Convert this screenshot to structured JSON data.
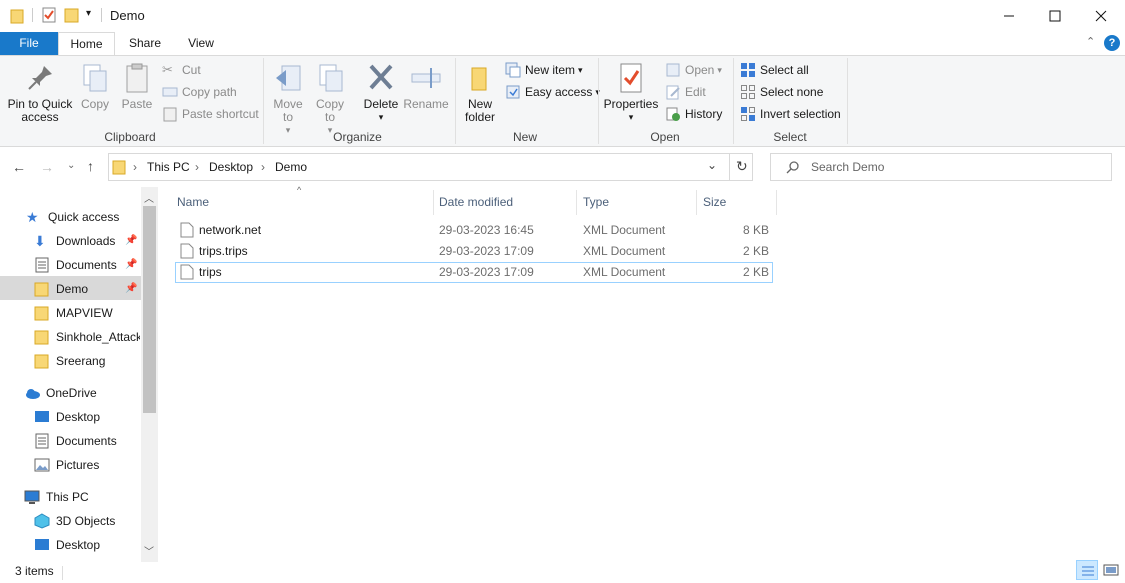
{
  "window": {
    "title": "Demo"
  },
  "tabs": {
    "file": "File",
    "home": "Home",
    "share": "Share",
    "view": "View"
  },
  "ribbon": {
    "clipboard": {
      "label": "Clipboard",
      "pin": "Pin to Quick access",
      "copy": "Copy",
      "paste": "Paste",
      "cut": "Cut",
      "copy_path": "Copy path",
      "paste_shortcut": "Paste shortcut"
    },
    "organize": {
      "label": "Organize",
      "move_to": "Move to",
      "copy_to": "Copy to",
      "delete": "Delete",
      "rename": "Rename"
    },
    "new": {
      "label": "New",
      "new_folder": "New folder",
      "new_item": "New item",
      "easy_access": "Easy access"
    },
    "open": {
      "label": "Open",
      "properties": "Properties",
      "open": "Open",
      "edit": "Edit",
      "history": "History"
    },
    "select": {
      "label": "Select",
      "select_all": "Select all",
      "select_none": "Select none",
      "invert": "Invert selection"
    }
  },
  "address": {
    "crumbs": [
      "This PC",
      "Desktop",
      "Demo"
    ],
    "search_placeholder": "Search Demo"
  },
  "nav": {
    "quick_access": "Quick access",
    "items": [
      {
        "label": "Downloads",
        "pinned": true
      },
      {
        "label": "Documents",
        "pinned": true
      },
      {
        "label": "Demo",
        "pinned": true
      },
      {
        "label": "MAPVIEW",
        "pinned": false
      },
      {
        "label": "Sinkhole_Attack_",
        "pinned": false
      },
      {
        "label": "Sreerang",
        "pinned": false
      }
    ],
    "onedrive": "OneDrive",
    "onedrive_items": [
      "Desktop",
      "Documents",
      "Pictures"
    ],
    "this_pc": "This PC",
    "this_pc_items": [
      "3D Objects",
      "Desktop"
    ]
  },
  "columns": {
    "name": "Name",
    "date": "Date modified",
    "type": "Type",
    "size": "Size"
  },
  "files": [
    {
      "name": "network.net",
      "date": "29-03-2023 16:45",
      "type": "XML Document",
      "size": "8 KB"
    },
    {
      "name": "trips.trips",
      "date": "29-03-2023 17:09",
      "type": "XML Document",
      "size": "2 KB"
    },
    {
      "name": "trips",
      "date": "29-03-2023 17:09",
      "type": "XML Document",
      "size": "2 KB"
    }
  ],
  "status": {
    "count": "3 items"
  },
  "colors": {
    "accent": "#1979ca",
    "selection": "#cce8ff",
    "folder": "#f8d775"
  }
}
